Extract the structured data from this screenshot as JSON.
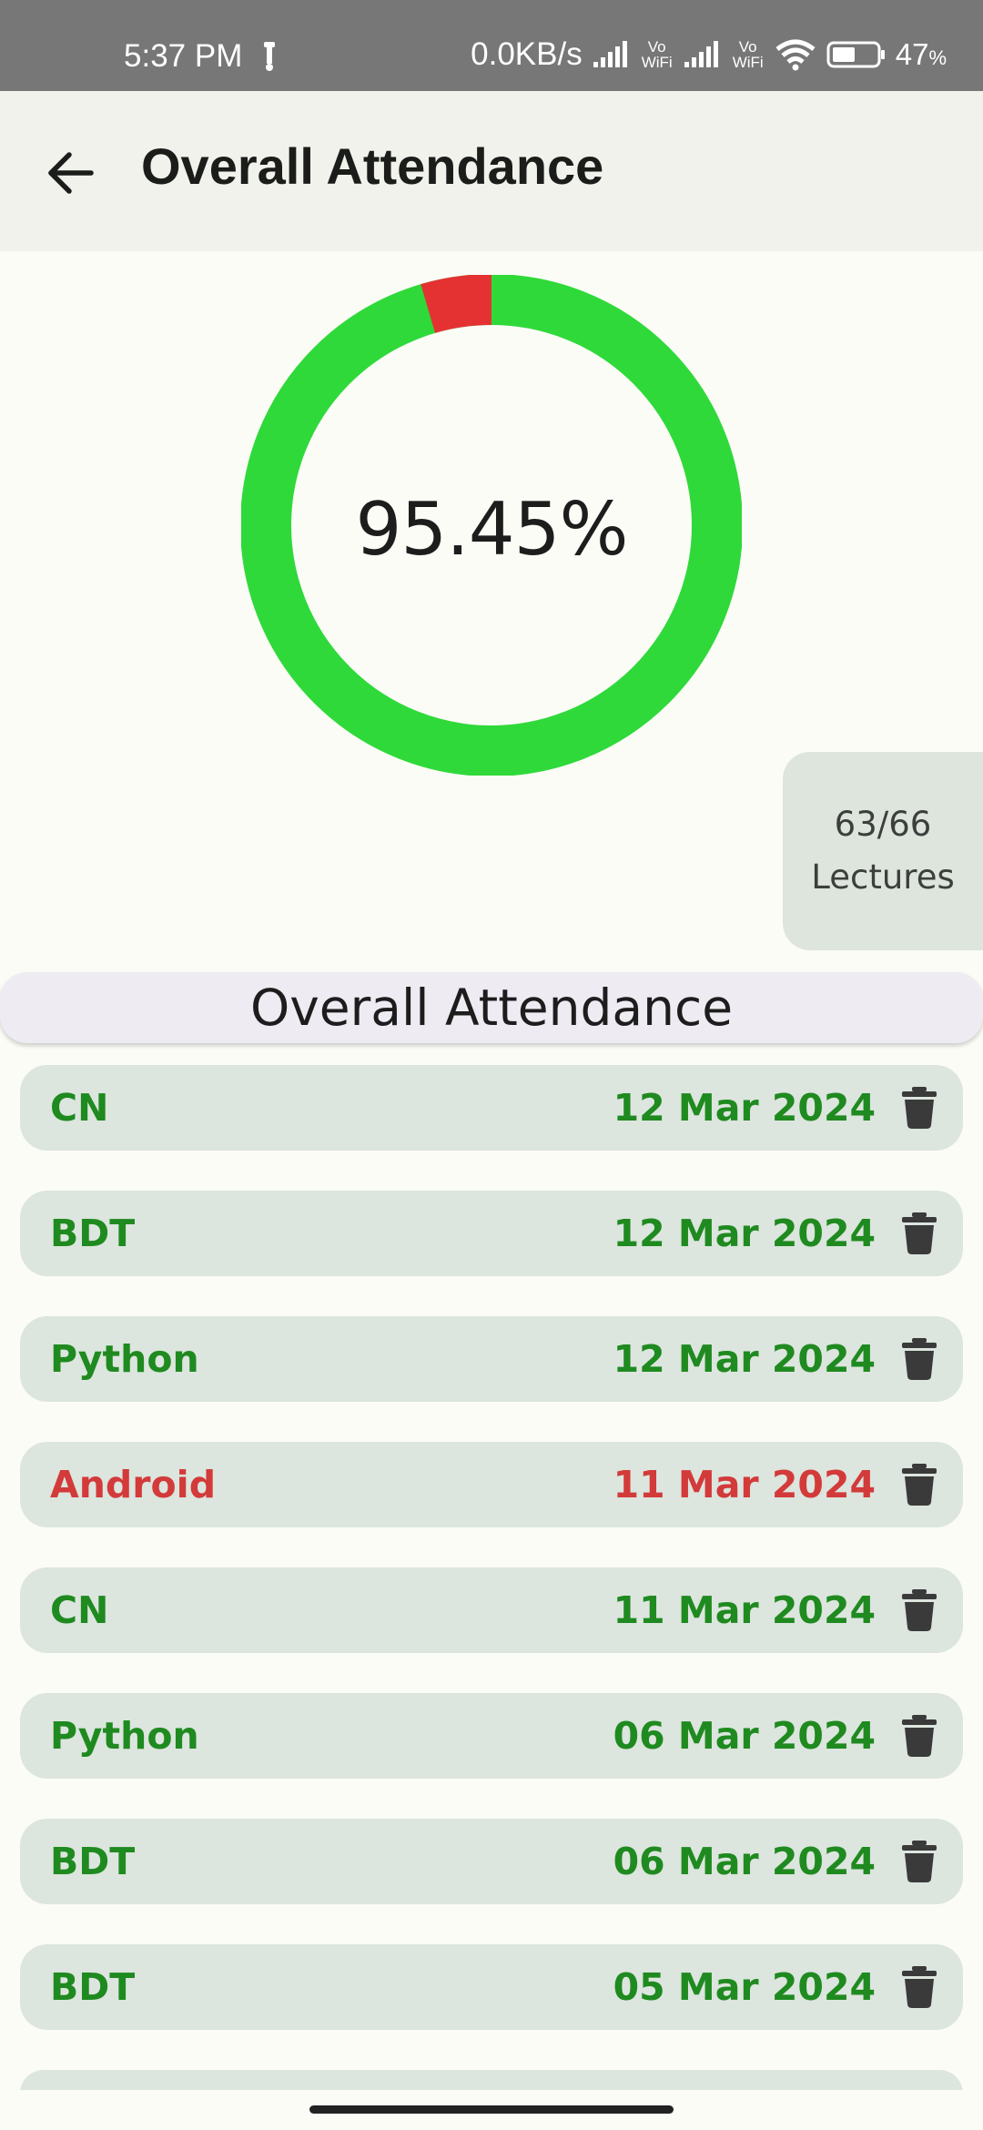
{
  "status": {
    "time": "5:37 PM",
    "speed": "0.0KB/s",
    "vowifi_top": "Vo",
    "vowifi_bottom": "WiFi",
    "battery": "47",
    "battery_unit": "%"
  },
  "header": {
    "title": "Overall Attendance"
  },
  "summary": {
    "percent_text": "95.45%",
    "attended": 63,
    "total": 66,
    "lectures_count": "63/66",
    "lectures_label": "Lectures",
    "present_color": "#2fd93a",
    "absent_color": "#e43232"
  },
  "section": {
    "title": "Overall Attendance"
  },
  "records": [
    {
      "subject": "CN",
      "date": "12 Mar 2024",
      "status": "present"
    },
    {
      "subject": "BDT",
      "date": "12 Mar 2024",
      "status": "present"
    },
    {
      "subject": "Python",
      "date": "12 Mar 2024",
      "status": "present"
    },
    {
      "subject": "Android",
      "date": "11 Mar 2024",
      "status": "absent"
    },
    {
      "subject": "CN",
      "date": "11 Mar 2024",
      "status": "present"
    },
    {
      "subject": "Python",
      "date": "06 Mar 2024",
      "status": "present"
    },
    {
      "subject": "BDT",
      "date": "06 Mar 2024",
      "status": "present"
    },
    {
      "subject": "BDT",
      "date": "05 Mar 2024",
      "status": "present"
    }
  ],
  "icons": {
    "back": "arrow-left-icon",
    "delete": "trash-icon"
  },
  "colors": {
    "present_text": "#1f8a1f",
    "absent_text": "#d33a3a",
    "row_bg": "#dce5de"
  }
}
